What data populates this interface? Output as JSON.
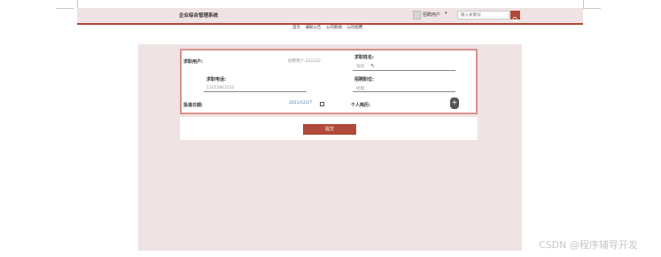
{
  "header": {
    "app_title": "企业综合管理系统",
    "user_label": "招聘用户",
    "user_caret": "▾",
    "search_placeholder": "输入关键词"
  },
  "subnav": {
    "items": [
      "首页",
      "通知公告",
      "公司新闻",
      "公司招聘"
    ]
  },
  "form": {
    "applicant_user_label": "求职用户:",
    "applicant_user_value": "招聘用户-222222",
    "applicant_name_label": "求职姓名:",
    "applicant_name_value": "张四",
    "phone_label": "求职电话:",
    "phone_value": "13255863522",
    "position_label": "招聘职位:",
    "position_value": "经理",
    "date_label": "投递日期:",
    "date_value": "2021/12/27",
    "resume_label": "个人简历:",
    "upload_symbol": "+"
  },
  "actions": {
    "submit_label": "提交"
  },
  "watermark": "CSDN @程序辅导开发"
}
